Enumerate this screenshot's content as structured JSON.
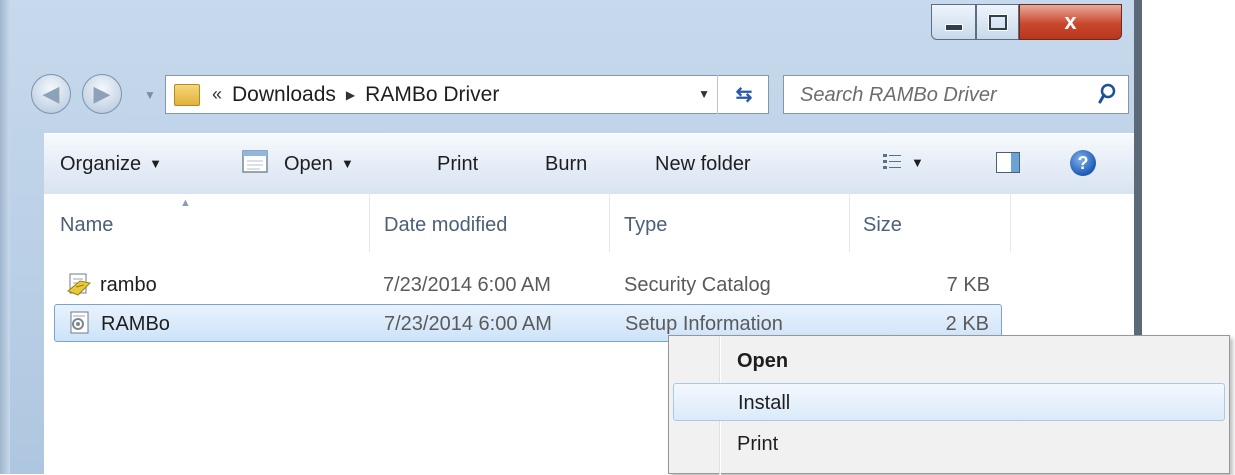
{
  "window": {
    "close_label": "x"
  },
  "address": {
    "overflow": "«",
    "crumbs": [
      "Downloads",
      "RAMBo Driver"
    ]
  },
  "search": {
    "placeholder": "Search RAMBo Driver"
  },
  "toolbar": {
    "organize": "Organize",
    "open": "Open",
    "print": "Print",
    "burn": "Burn",
    "new_folder": "New folder",
    "help": "?"
  },
  "columns": {
    "name": "Name",
    "date": "Date modified",
    "type": "Type",
    "size": "Size"
  },
  "files": [
    {
      "name": "rambo",
      "date": "7/23/2014 6:00 AM",
      "type": "Security Catalog",
      "size": "7 KB",
      "icon": "security-catalog-icon",
      "selected": false
    },
    {
      "name": "RAMBo",
      "date": "7/23/2014 6:00 AM",
      "type": "Setup Information",
      "size": "2 KB",
      "icon": "setup-information-icon",
      "selected": true
    }
  ],
  "context_menu": {
    "items": [
      {
        "label": "Open",
        "default": true
      },
      {
        "label": "Install",
        "highlighted": true
      },
      {
        "label": "Print"
      }
    ]
  },
  "colors": {
    "selection_border": "#7da2ce",
    "close_button": "#c9482d",
    "frame": "#b9cfe6"
  }
}
